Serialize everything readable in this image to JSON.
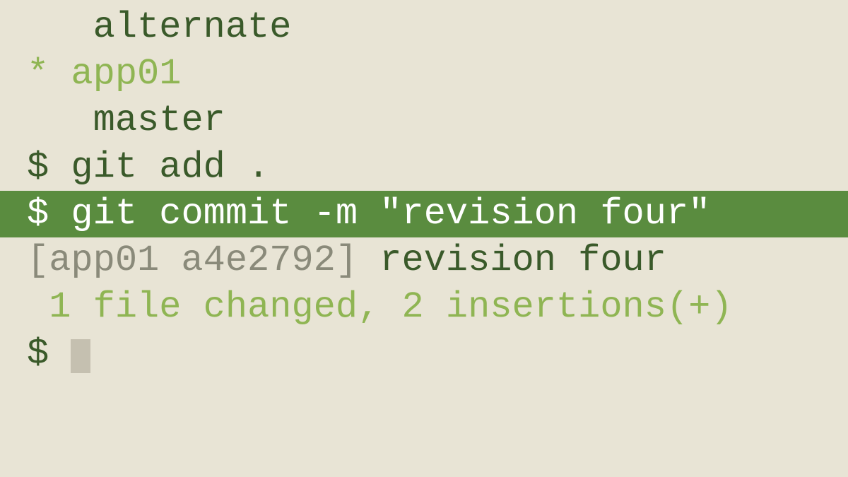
{
  "branches": {
    "indent": "   ",
    "alternate": "alternate",
    "current_marker": "* ",
    "current": "app01",
    "master": "master"
  },
  "prompt": "$ ",
  "commands": {
    "add": "git add .",
    "commit": "git commit -m \"revision four\""
  },
  "output": {
    "commit_prefix": "[app01 a4e2792]",
    "commit_message": " revision four",
    "stats_indent": " ",
    "stats": "1 file changed, 2 insertions(+)"
  }
}
